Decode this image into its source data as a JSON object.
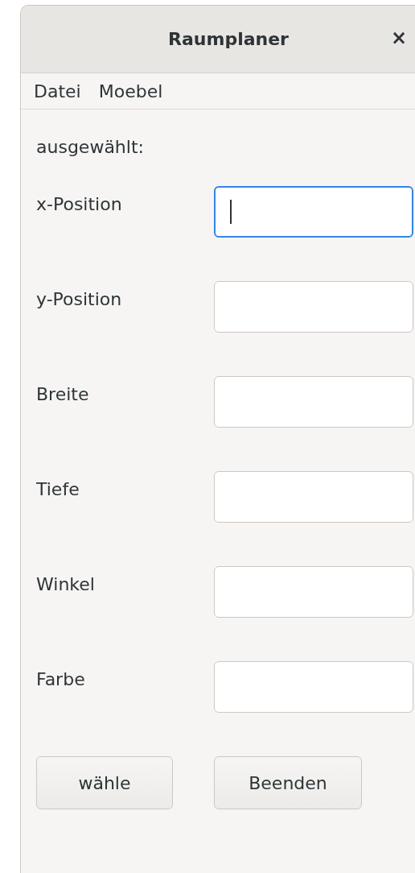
{
  "window": {
    "title": "Raumplaner",
    "close": "×"
  },
  "menu": [
    "Datei",
    "Moebel"
  ],
  "selected_label": "ausgewählt:",
  "fields": [
    {
      "label": "x-Position",
      "focused": true
    },
    {
      "label": "y-Position",
      "focused": false
    },
    {
      "label": "Breite",
      "focused": false
    },
    {
      "label": "Tiefe",
      "focused": false
    },
    {
      "label": "Winkel",
      "focused": false
    },
    {
      "label": "Farbe",
      "focused": false
    }
  ],
  "buttons": [
    "wähle",
    "Beenden"
  ]
}
